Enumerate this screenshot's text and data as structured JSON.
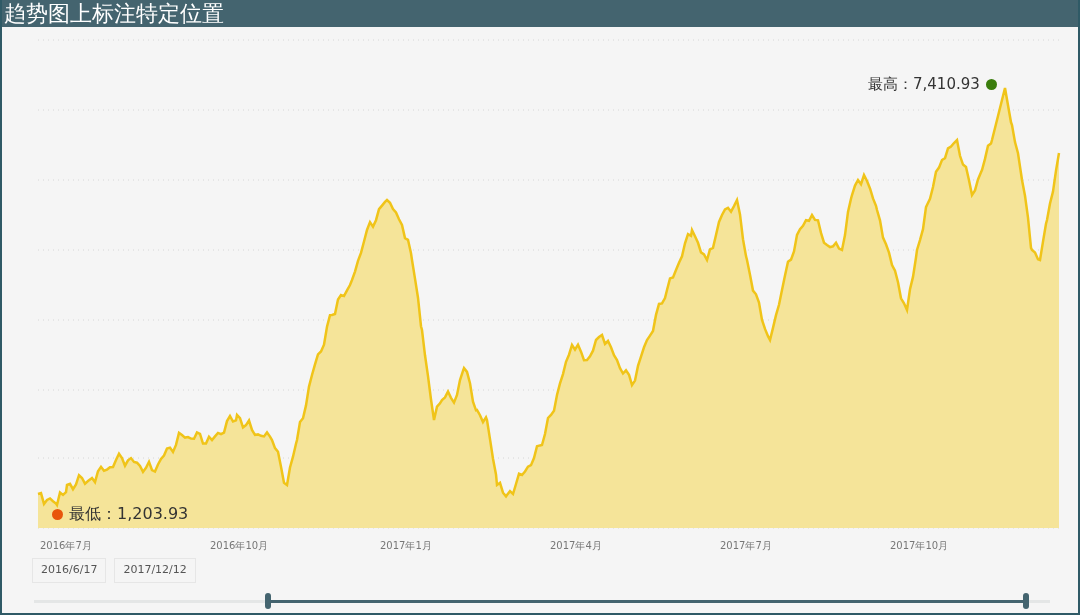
{
  "title": "趋势图上标注特定位置",
  "chart": {
    "x_labels": [
      "2016年7月",
      "2016年10月",
      "2017年1月",
      "2017年4月",
      "2017年7月",
      "2017年10月"
    ],
    "annotations": [
      {
        "kind": "low",
        "label": "最低：",
        "value": "1,203.93",
        "color": "#e8560c"
      },
      {
        "kind": "high",
        "label": "最高：",
        "value": "7,410.93",
        "color": "#3a7d0c"
      }
    ]
  },
  "date_range": {
    "start": "2016/6/17",
    "end": "2017/12/12"
  },
  "range_slider": {
    "handles": [
      {
        "level": 0.23
      },
      {
        "level": 0.976
      }
    ]
  }
}
